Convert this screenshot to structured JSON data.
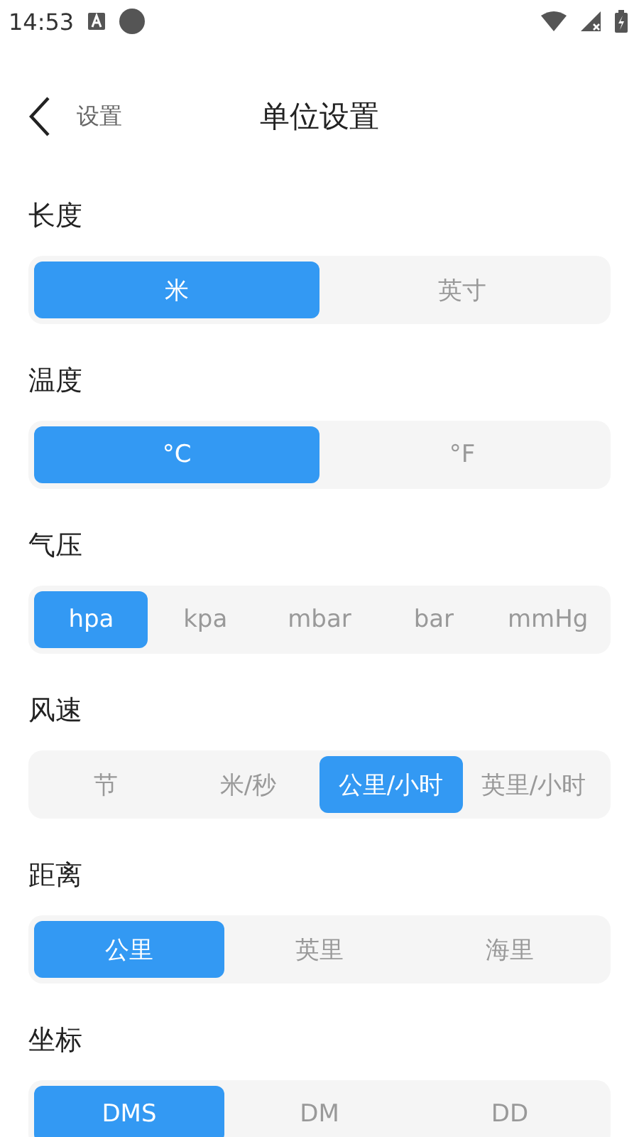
{
  "status_bar": {
    "time": "14:53"
  },
  "header": {
    "back_label": "设置",
    "title": "单位设置"
  },
  "sections": [
    {
      "label": "长度",
      "options": [
        {
          "label": "米",
          "selected": true
        },
        {
          "label": "英寸",
          "selected": false
        }
      ]
    },
    {
      "label": "温度",
      "options": [
        {
          "label": "°C",
          "selected": true
        },
        {
          "label": "°F",
          "selected": false
        }
      ]
    },
    {
      "label": "气压",
      "options": [
        {
          "label": "hpa",
          "selected": true
        },
        {
          "label": "kpa",
          "selected": false
        },
        {
          "label": "mbar",
          "selected": false
        },
        {
          "label": "bar",
          "selected": false
        },
        {
          "label": "mmHg",
          "selected": false
        }
      ]
    },
    {
      "label": "风速",
      "options": [
        {
          "label": "节",
          "selected": false
        },
        {
          "label": "米/秒",
          "selected": false
        },
        {
          "label": "公里/小时",
          "selected": true
        },
        {
          "label": "英里/小时",
          "selected": false
        }
      ]
    },
    {
      "label": "距离",
      "options": [
        {
          "label": "公里",
          "selected": true
        },
        {
          "label": "英里",
          "selected": false
        },
        {
          "label": "海里",
          "selected": false
        }
      ]
    },
    {
      "label": "坐标",
      "options": [
        {
          "label": "DMS",
          "selected": true
        },
        {
          "label": "DM",
          "selected": false
        },
        {
          "label": "DD",
          "selected": false
        }
      ]
    }
  ]
}
